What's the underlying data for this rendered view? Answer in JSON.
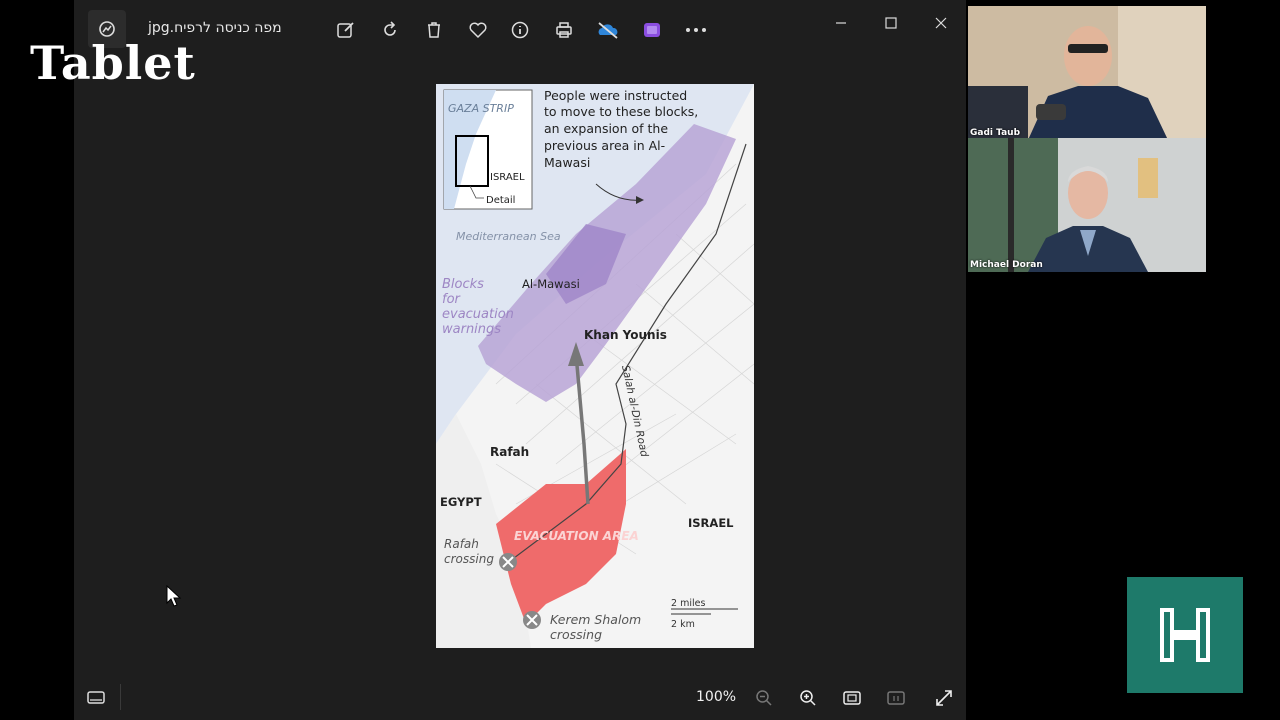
{
  "window": {
    "title": "מפה כניסה לרפיח.jpg"
  },
  "toolbar": {
    "icons": [
      "edit-image-icon",
      "rotate-icon",
      "delete-icon",
      "favorite-icon",
      "info-icon",
      "print-icon",
      "onedrive-icon",
      "clipchamp-icon",
      "more-icon"
    ]
  },
  "brand": {
    "tablet": "Tablet"
  },
  "statusbar": {
    "zoom": "100%"
  },
  "map": {
    "inset": {
      "gaza_strip": "GAZA STRIP",
      "israel": "ISRAEL",
      "detail": "Detail"
    },
    "annotation": "People were instructed to move to these blocks, an expansion of the previous area in Al-Mawasi",
    "annotation_lines": [
      "People were instructed",
      "to move to these blocks,",
      "an expansion of the",
      "previous area in Al-",
      "Mawasi"
    ],
    "sea": "Mediterranean Sea",
    "blocks_lines": [
      "Blocks",
      "for",
      "evacuation",
      "warnings"
    ],
    "al_mawasi": "Al-Mawasi",
    "khan_younis": "Khan Younis",
    "road": "Salah al-Din Road",
    "rafah": "Rafah",
    "egypt": "EGYPT",
    "israel": "ISRAEL",
    "evac": "EVACUATION AREA",
    "rafah_crossing_lines": [
      "Rafah",
      "crossing"
    ],
    "kerem_lines": [
      "Kerem Shalom",
      "crossing"
    ],
    "scale_miles": "2 miles",
    "scale_km": "2 km",
    "colors": {
      "purple": "#b9a5d6",
      "red": "#ef6b6b",
      "sea": "#dfe6f2"
    }
  },
  "participants": [
    {
      "name": "Gadi Taub"
    },
    {
      "name": "Michael Doran"
    }
  ]
}
